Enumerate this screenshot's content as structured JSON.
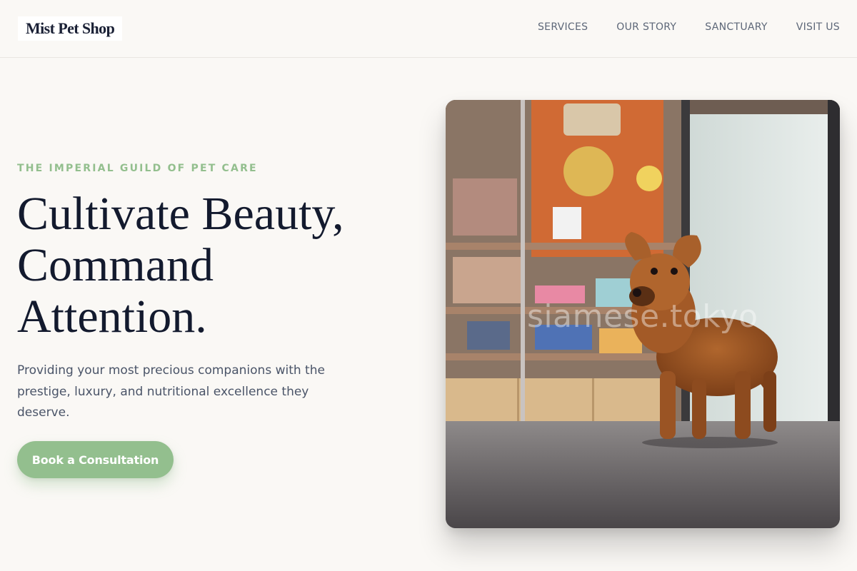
{
  "brand": {
    "name": "Mist Pet Shop"
  },
  "nav": {
    "items": [
      {
        "label": "SERVICES"
      },
      {
        "label": "OUR STORY"
      },
      {
        "label": "SANCTUARY"
      },
      {
        "label": "VISIT US"
      }
    ]
  },
  "hero": {
    "eyebrow": "THE IMPERIAL GUILD OF PET CARE",
    "headline": [
      "Cultivate Beauty,",
      "Command",
      "Attention."
    ],
    "subtext": "Providing your most precious companions with the prestige, luxury, and nutritional excellence they deserve.",
    "cta_label": "Book a Consultation",
    "image": {
      "subject": "brown puppy standing on the floor of a pet shop",
      "watermark": "siamese.tokyo"
    }
  },
  "colors": {
    "background": "#faf8f5",
    "accent_green": "#93bf8e",
    "heading": "#131a2e",
    "body_text": "#4a5468",
    "nav_text": "#5d6778"
  }
}
